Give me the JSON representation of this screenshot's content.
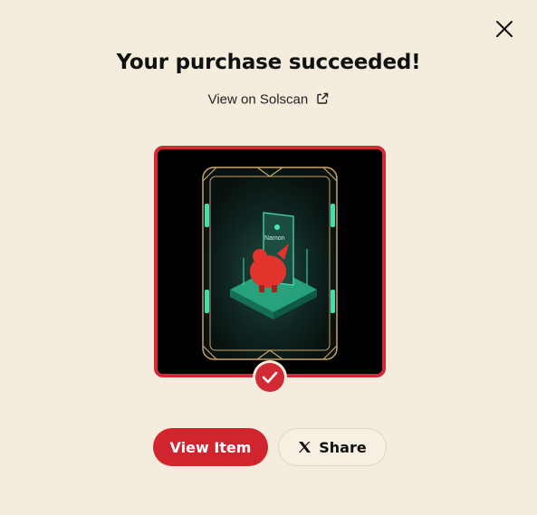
{
  "modal": {
    "title": "Your purchase succeeded!",
    "solscan_link": "View on Solscan",
    "item_image": {
      "card_text": "Namon",
      "alt": "NFT card illustration"
    },
    "status": "success",
    "buttons": {
      "view_item": "View Item",
      "share": "Share"
    }
  },
  "icons": {
    "close": "close-icon",
    "external_link": "external-link-icon",
    "check": "check-icon",
    "x_logo": "x-logo-icon"
  },
  "colors": {
    "background": "#f4ecdd",
    "accent": "#d12a35",
    "text": "#111111"
  }
}
